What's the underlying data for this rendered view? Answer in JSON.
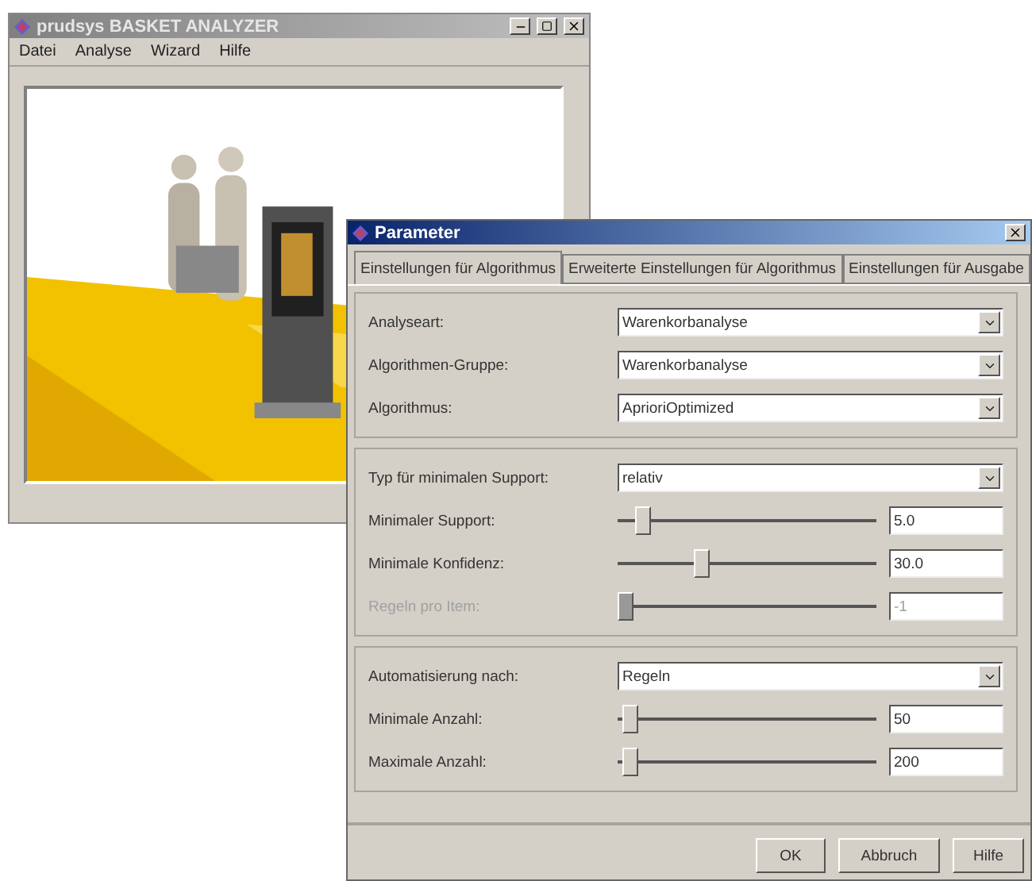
{
  "main_window": {
    "title": "prudsys BASKET ANALYZER",
    "menu": [
      "Datei",
      "Analyse",
      "Wizard",
      "Hilfe"
    ]
  },
  "dialog": {
    "title": "Parameter",
    "tabs": [
      {
        "label": "Einstellungen für Algorithmus",
        "selected": true
      },
      {
        "label": "Erweiterte Einstellungen für Algorithmus",
        "selected": false
      },
      {
        "label": "Einstellungen für Ausgabe",
        "selected": false
      }
    ],
    "sections": [
      {
        "rows": [
          {
            "kind": "dropdown",
            "label": "Analyseart:",
            "value": "Warenkorbanalyse",
            "disabled": false
          },
          {
            "kind": "dropdown",
            "label": "Algorithmen-Gruppe:",
            "value": "Warenkorbanalyse",
            "disabled": false
          },
          {
            "kind": "dropdown",
            "label": "Algorithmus:",
            "value": "AprioriOptimized",
            "disabled": false
          }
        ]
      },
      {
        "rows": [
          {
            "kind": "dropdown",
            "label": "Typ für minimalen Support:",
            "value": "relativ",
            "disabled": false
          },
          {
            "kind": "slider",
            "label": "Minimaler Support:",
            "level": 0.07,
            "value": "5.0",
            "disabled": false
          },
          {
            "kind": "slider",
            "label": "Minimale Konfidenz:",
            "level": 0.3,
            "value": "30.0",
            "disabled": false
          },
          {
            "kind": "slider",
            "label": "Regeln pro Item:",
            "level": 0,
            "value": "-1",
            "disabled": true
          }
        ]
      },
      {
        "rows": [
          {
            "kind": "dropdown",
            "label": "Automatisierung nach:",
            "value": "Regeln",
            "disabled": false
          },
          {
            "kind": "slider",
            "label": "Minimale Anzahl:",
            "level": 0.02,
            "value": "50",
            "disabled": false
          },
          {
            "kind": "slider",
            "label": "Maximale Anzahl:",
            "level": 0.02,
            "value": "200",
            "disabled": false
          }
        ]
      }
    ],
    "buttons": [
      "OK",
      "Abbruch",
      "Hilfe"
    ]
  }
}
